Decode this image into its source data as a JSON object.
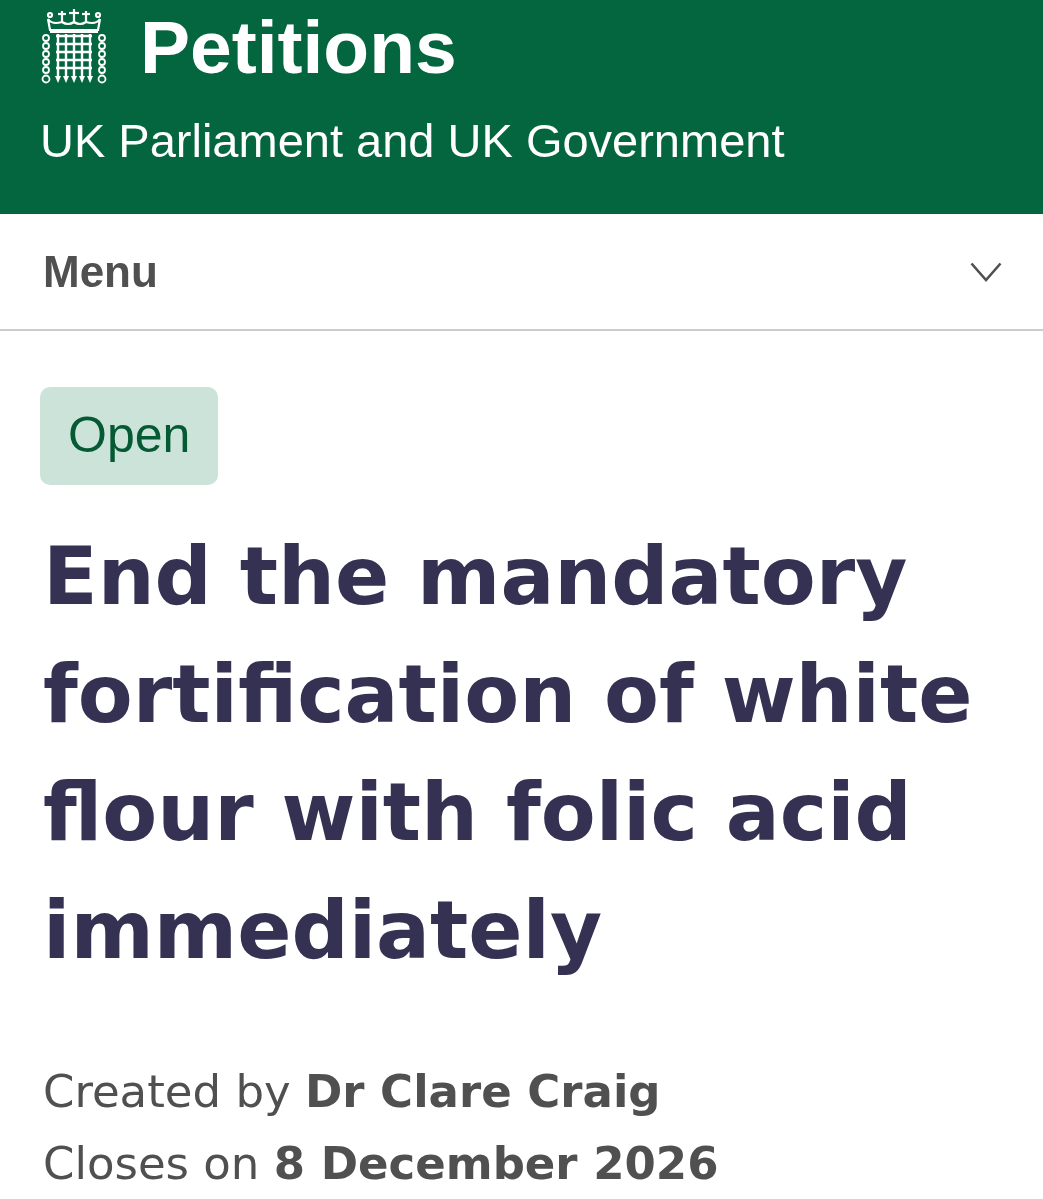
{
  "header": {
    "title": "Petitions",
    "subtitle": "UK Parliament and UK Government"
  },
  "menu": {
    "label": "Menu",
    "expanded": false
  },
  "petition": {
    "status": "Open",
    "title": "End the mandatory fortification of white flour with folic acid immediately",
    "details": [
      "Created by **Dr Clare Craig**",
      "Closes on **8 December 2026**"
    ]
  }
}
